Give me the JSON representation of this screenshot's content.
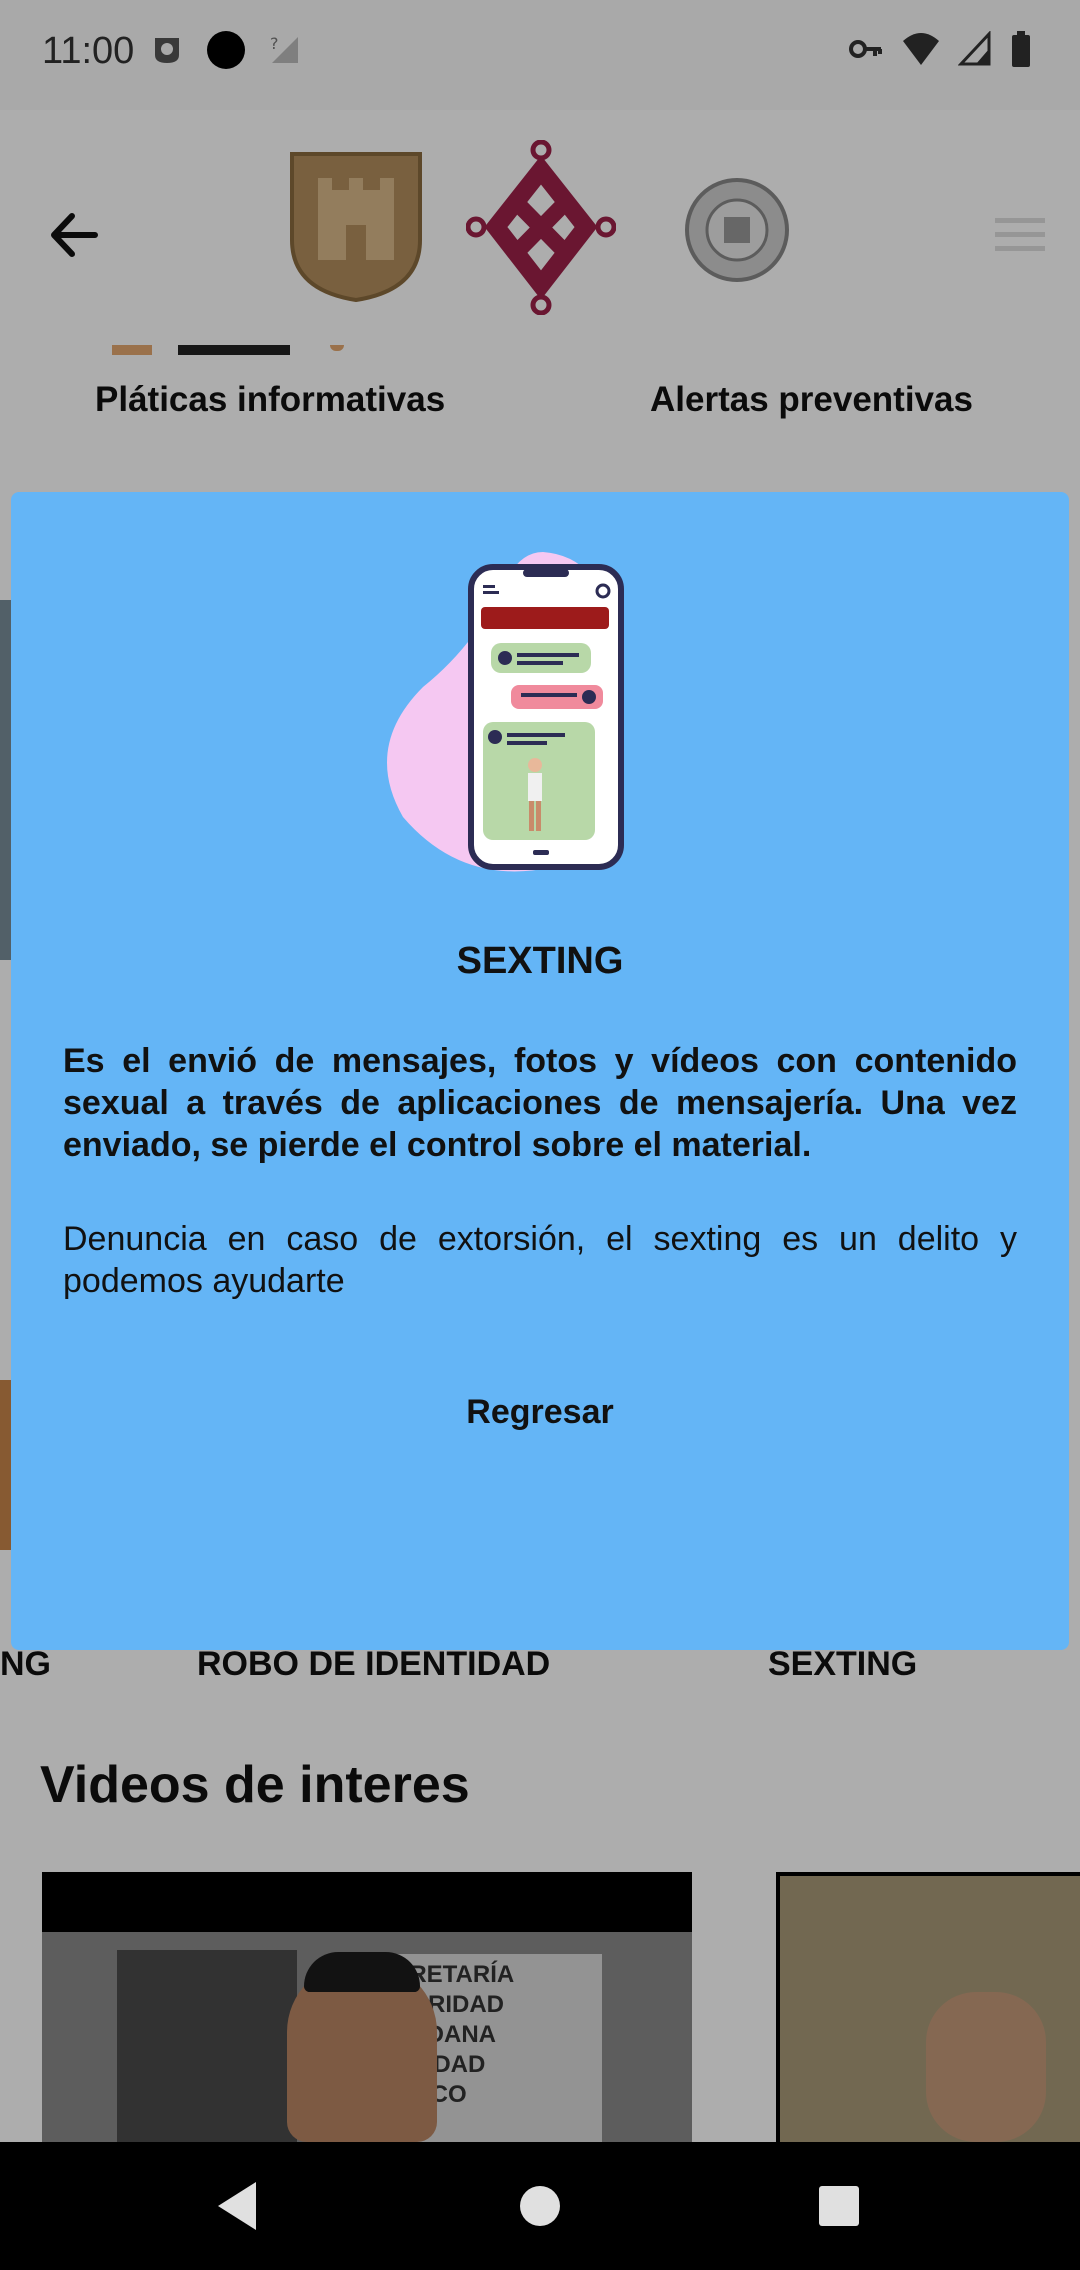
{
  "status_bar": {
    "time": "11:00"
  },
  "app_bar": {
    "back_icon": "arrow-left-icon",
    "logos": [
      "cdmx-shield-logo",
      "cdmx-knot-logo",
      "police-badge-logo"
    ],
    "menu_icon": "hamburger-icon"
  },
  "top_categories": [
    "Pláticas informativas",
    "Alertas preventivas"
  ],
  "carousel": {
    "items": [
      "NG",
      "ROBO DE IDENTIDAD",
      "SEXTING"
    ]
  },
  "videos_section": {
    "title": "Videos de interes",
    "video_overlay_text": "CRETARÍA\nGURIDAD\nDADANA\nCIUDAD\nÉXICO"
  },
  "dialog": {
    "title": "SEXTING",
    "body_bold": "Es el envió de mensajes, fotos y vídeos con contenido sexual a través de aplicaciones de mensajería. Una vez enviado, se pierde el control sobre el material.",
    "body_normal": "Denuncia en caso de extorsión, el sexting es un delito y podemos ayudarte",
    "back_button": "Regresar"
  },
  "colors": {
    "dialog_background": "#64b5f6",
    "brand_maroon": "#9d2149",
    "brand_gold": "#b38e5d"
  }
}
